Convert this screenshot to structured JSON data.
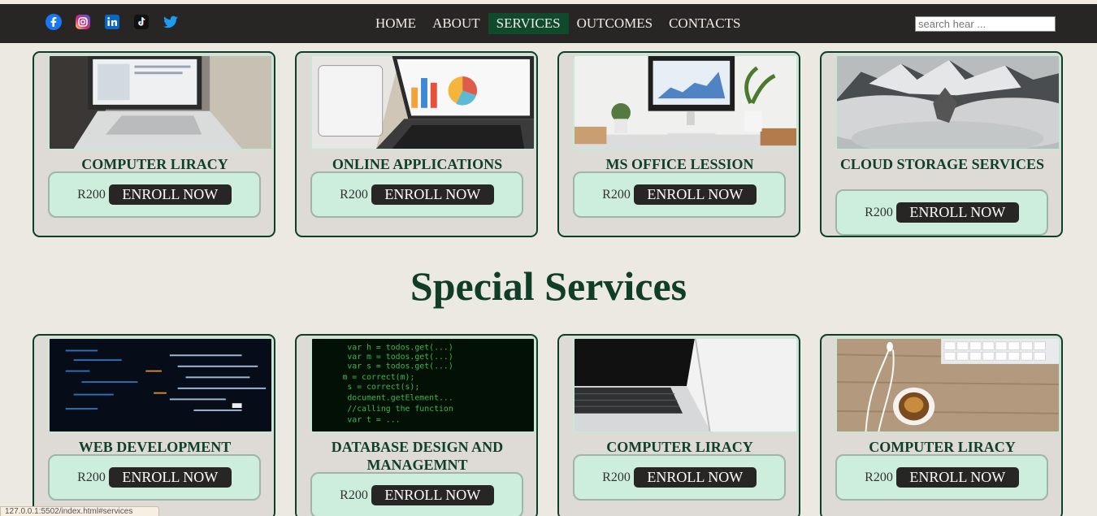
{
  "nav": {
    "social": [
      "facebook-icon",
      "instagram-icon",
      "linkedin-icon",
      "tiktok-icon",
      "twitter-icon"
    ],
    "items": [
      {
        "label": "HOME",
        "active": false
      },
      {
        "label": "ABOUT",
        "active": false
      },
      {
        "label": "SERVICES",
        "active": true
      },
      {
        "label": "OUTCOMES",
        "active": false
      },
      {
        "label": "CONTACTS",
        "active": false
      }
    ],
    "search_placeholder": "search hear ..."
  },
  "services": [
    {
      "title": "COMPUTER LIRACY",
      "price": "R200",
      "button": "ENROLL NOW"
    },
    {
      "title": "ONLINE APPLICATIONS",
      "price": "R200",
      "button": "ENROLL NOW"
    },
    {
      "title": "MS OFFICE LESSION",
      "price": "R200",
      "button": "ENROLL NOW"
    },
    {
      "title": "CLOUD STORAGE SERVICES",
      "price": "R200",
      "button": "ENROLL NOW"
    }
  ],
  "special": {
    "heading": "Special Services",
    "items": [
      {
        "title": "WEB DEVELOPMENT",
        "price": "R200",
        "button": "ENROLL NOW"
      },
      {
        "title": "DATABASE DESIGN AND MANAGEMNT",
        "price": "R200",
        "button": "ENROLL NOW"
      },
      {
        "title": "COMPUTER LIRACY",
        "price": "R200",
        "button": "ENROLL NOW"
      },
      {
        "title": "COMPUTER LIRACY",
        "price": "R200",
        "button": "ENROLL NOW"
      }
    ]
  },
  "status_url": "127.0.0.1:5502/index.html#services",
  "colors": {
    "nav_bg": "#282624",
    "accent": "#0f4a2c",
    "card_bg": "#dedad6",
    "price_bg": "#cdeedd"
  }
}
